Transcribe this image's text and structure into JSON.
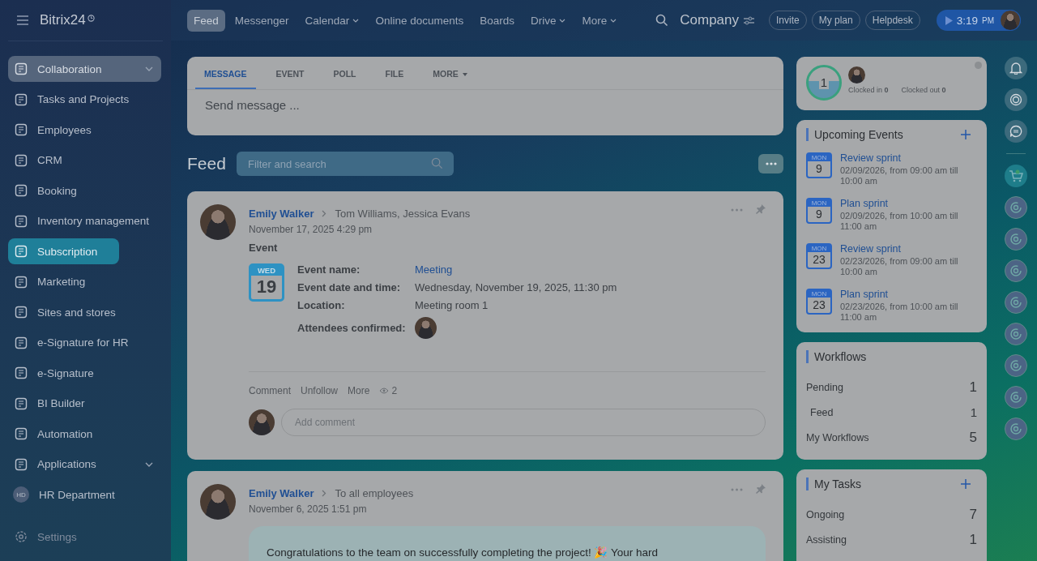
{
  "logo": {
    "text": "Bitrix24"
  },
  "sidebar": {
    "items": [
      {
        "label": "Collaboration",
        "kind": "group",
        "selected": false,
        "hovered": true
      },
      {
        "label": "Tasks and Projects",
        "kind": "item",
        "selected": false,
        "hovered": false
      },
      {
        "label": "Employees",
        "kind": "item",
        "selected": false,
        "hovered": false
      },
      {
        "label": "CRM",
        "kind": "item",
        "selected": false,
        "hovered": false
      },
      {
        "label": "Booking",
        "kind": "item",
        "selected": false,
        "hovered": false
      },
      {
        "label": "Inventory management",
        "kind": "item",
        "selected": false,
        "hovered": false
      },
      {
        "label": "Subscription",
        "kind": "item",
        "selected": true,
        "hovered": false
      },
      {
        "label": "Marketing",
        "kind": "item",
        "selected": false,
        "hovered": false
      },
      {
        "label": "Sites and stores",
        "kind": "item",
        "selected": false,
        "hovered": false
      },
      {
        "label": "e-Signature for HR",
        "kind": "item",
        "selected": false,
        "hovered": false
      },
      {
        "label": "e-Signature",
        "kind": "item",
        "selected": false,
        "hovered": false
      },
      {
        "label": "BI Builder",
        "kind": "item",
        "selected": false,
        "hovered": false
      },
      {
        "label": "Automation",
        "kind": "item",
        "selected": false,
        "hovered": false
      },
      {
        "label": "Applications",
        "kind": "group",
        "selected": false,
        "hovered": false
      },
      {
        "label": "HR Department",
        "kind": "department",
        "badge": "HD",
        "selected": false,
        "hovered": false
      }
    ],
    "settings": "Settings"
  },
  "top_nav": [
    {
      "label": "Feed",
      "selected": true,
      "dropdown": false
    },
    {
      "label": "Messenger",
      "selected": false,
      "dropdown": false
    },
    {
      "label": "Calendar",
      "selected": false,
      "dropdown": true
    },
    {
      "label": "Online documents",
      "selected": false,
      "dropdown": false
    },
    {
      "label": "Boards",
      "selected": false,
      "dropdown": false
    },
    {
      "label": "Drive",
      "selected": false,
      "dropdown": true
    },
    {
      "label": "More",
      "selected": false,
      "dropdown": true
    }
  ],
  "company": "Company",
  "header_buttons": [
    "Invite",
    "My plan",
    "Helpdesk"
  ],
  "clock": {
    "time": "3:19",
    "suffix": "PM"
  },
  "composer": {
    "tabs": [
      {
        "label": "MESSAGE",
        "selected": true,
        "dropdown": false
      },
      {
        "label": "EVENT",
        "selected": false,
        "dropdown": false
      },
      {
        "label": "POLL",
        "selected": false,
        "dropdown": false
      },
      {
        "label": "FILE",
        "selected": false,
        "dropdown": false
      },
      {
        "label": "MORE",
        "selected": false,
        "dropdown": true
      }
    ],
    "placeholder": "Send message ..."
  },
  "feed": {
    "title": "Feed",
    "filter_placeholder": "Filter and search"
  },
  "posts": [
    {
      "kind": "event",
      "author": "Emily Walker",
      "recipients": "Tom Williams, Jessica Evans",
      "date": "November 17, 2025 4:29 pm",
      "event": {
        "heading": "Event",
        "weekday": "WED",
        "day": "19",
        "fields": [
          {
            "label": "Event name:",
            "value": "Meeting",
            "kind": "link"
          },
          {
            "label": "Event date and time:",
            "value": "Wednesday, November 19, 2025, 11:30 pm",
            "kind": "text"
          },
          {
            "label": "Location:",
            "value": "Meeting room 1",
            "kind": "text"
          },
          {
            "label": "Attendees confirmed:",
            "kind": "avatars"
          }
        ]
      },
      "actions": [
        "Comment",
        "Unfollow",
        "More"
      ],
      "views": "2",
      "comment_placeholder": "Add comment"
    },
    {
      "kind": "message",
      "author": "Emily Walker",
      "recipients": "To all employees",
      "date": "November 6, 2025 1:51 pm",
      "text": "Congratulations to the team on successfully completing the project! 🎉 Your hard"
    }
  ],
  "time_widget": {
    "count": "1",
    "clocked_in": "Clocked in **0**",
    "clocked_out": "Clocked out **0**"
  },
  "upcoming_events": {
    "title": "Upcoming Events",
    "items": [
      {
        "weekday": "MON",
        "day": "9",
        "title": "Review sprint",
        "time": "02/09/2026, from 09:00 am till 10:00 am"
      },
      {
        "weekday": "MON",
        "day": "9",
        "title": "Plan sprint",
        "time": "02/09/2026, from 10:00 am till 11:00 am"
      },
      {
        "weekday": "MON",
        "day": "23",
        "title": "Review sprint",
        "time": "02/23/2026, from 09:00 am till 10:00 am"
      },
      {
        "weekday": "MON",
        "day": "23",
        "title": "Plan sprint",
        "time": "02/23/2026, from 10:00 am till 11:00 am"
      }
    ]
  },
  "workflows": {
    "title": "Workflows",
    "rows": [
      {
        "label": "Pending",
        "count": "1",
        "children": [
          {
            "label": "Feed",
            "count": "1"
          }
        ]
      },
      {
        "label": "My Workflows",
        "count": "5"
      }
    ]
  },
  "my_tasks": {
    "title": "My Tasks",
    "rows": [
      {
        "label": "Ongoing",
        "count": "7"
      },
      {
        "label": "Assisting",
        "count": "1"
      }
    ]
  }
}
